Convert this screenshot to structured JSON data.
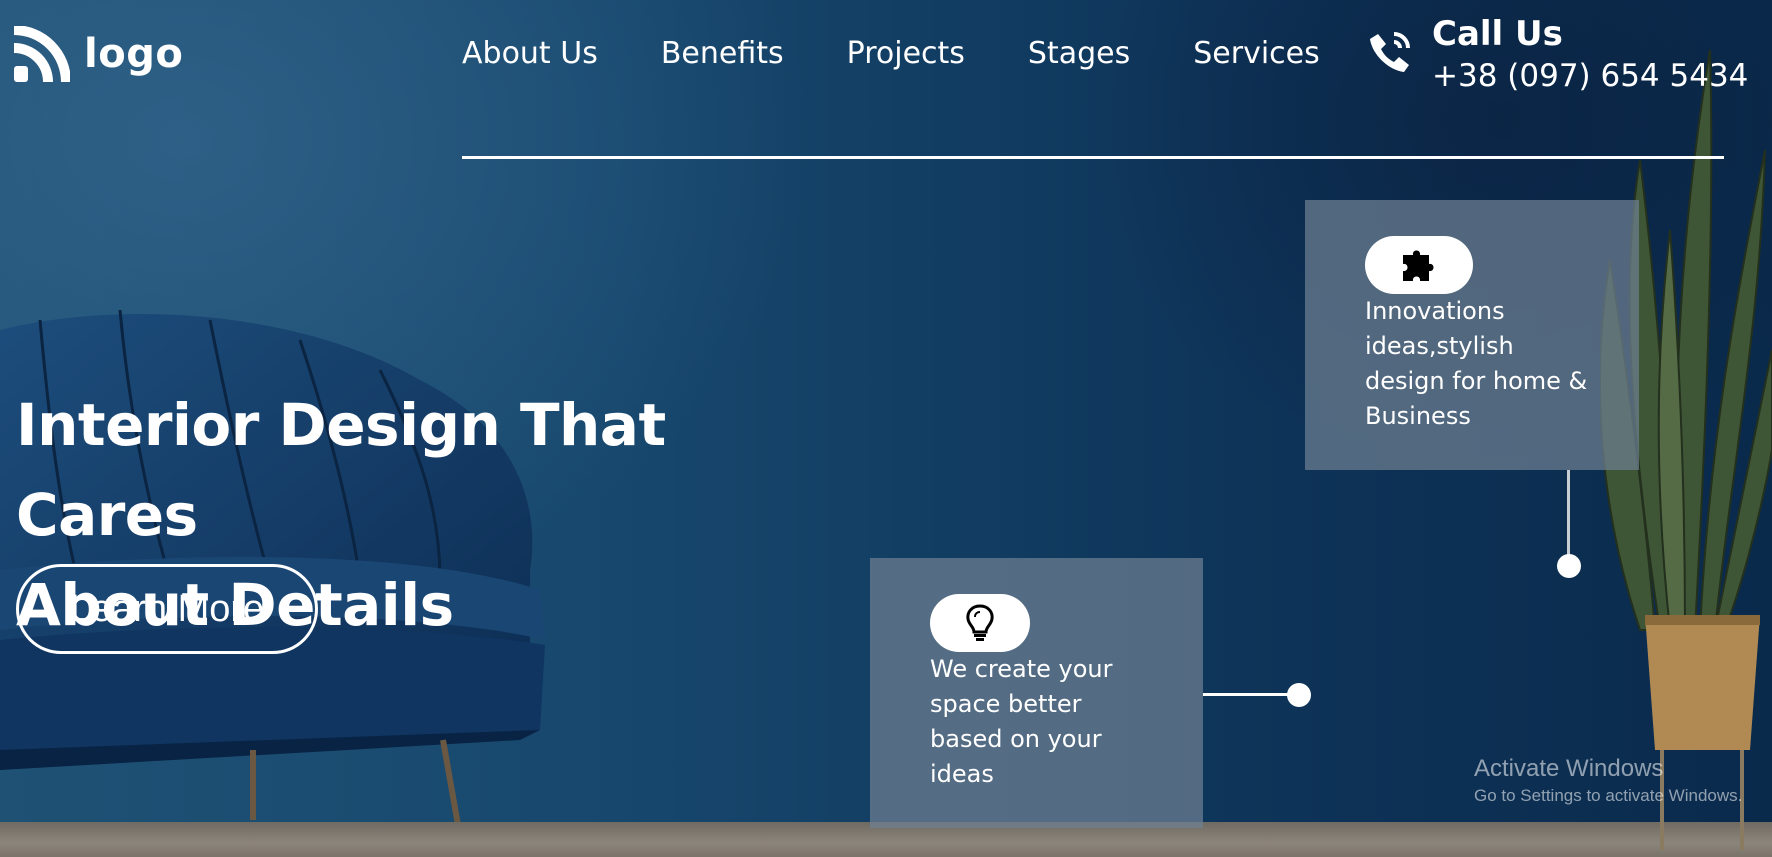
{
  "logo": {
    "text": "logo",
    "icon": "wifi-signal-logo-icon"
  },
  "nav": {
    "items": [
      {
        "label": "About Us"
      },
      {
        "label": "Benefits"
      },
      {
        "label": "Projects"
      },
      {
        "label": "Stages"
      },
      {
        "label": "Services"
      }
    ]
  },
  "contact": {
    "icon": "phone-ringing-icon",
    "title": "Call Us",
    "phone": "+38 (097) 654 5434"
  },
  "hero": {
    "headline_line1": "Interior Design That Cares",
    "headline_line2": "About Details",
    "cta_label": "Learn More"
  },
  "features": [
    {
      "icon": "puzzle-piece-icon",
      "text": "Innovations ideas,stylish design for home & Business"
    },
    {
      "icon": "lightbulb-icon",
      "text": "We create your space better based on your ideas"
    }
  ],
  "windows_watermark": {
    "title": "Activate Windows",
    "subtitle": "Go to Settings to activate Windows."
  },
  "colors": {
    "background": "#123a5c",
    "text": "#ffffff",
    "card": "#6e8091"
  }
}
